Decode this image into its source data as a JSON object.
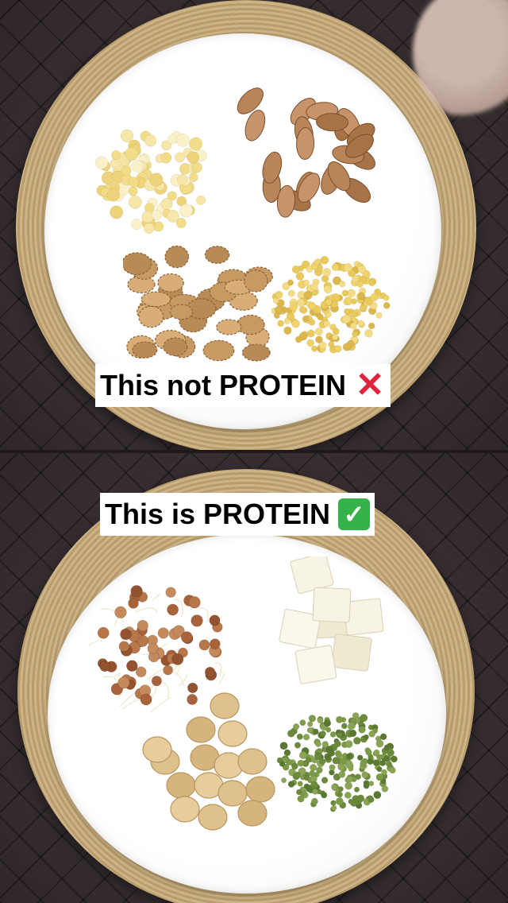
{
  "top": {
    "caption": "This not PROTEIN",
    "mark_icon": "cross-mark-icon",
    "foods": [
      "corn-kernels",
      "almonds",
      "walnuts",
      "chana-dal"
    ]
  },
  "bottom": {
    "caption": "This is PROTEIN",
    "mark_icon": "check-mark-icon",
    "foods": [
      "sprouts",
      "paneer-cubes",
      "soya-chunks",
      "green-moong"
    ]
  },
  "colors": {
    "cross": "#e0243b",
    "check": "#35b34a",
    "mat": "#c9ae7e",
    "background": "#3a3033"
  }
}
